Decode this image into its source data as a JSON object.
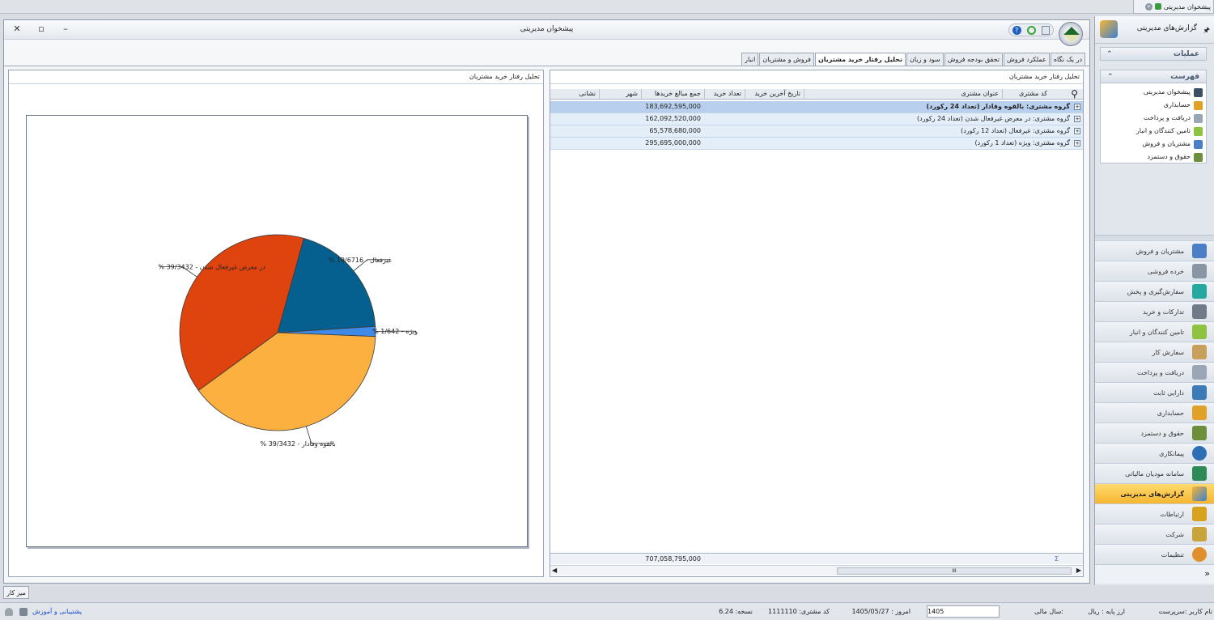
{
  "top_tab": {
    "label": "پیشخوان مدیریتی"
  },
  "window": {
    "title": "پیشخوان مدیریتی"
  },
  "tabs": [
    "در یک نگاه",
    "عملکرد فروش",
    "تحقق بودجه فروش",
    "سود و زیان",
    "تحلیل رفتار خرید مشتریان",
    "فروش و مشتریان",
    "انبار"
  ],
  "left_panel": {
    "title": "تحلیل رفتار خرید مشتریان"
  },
  "right_panel": {
    "title": "تحلیل رفتار خرید مشتریان"
  },
  "grid": {
    "headers": [
      "کد مشتری",
      "عنوان مشتری",
      "تاریخ آخرین خرید",
      "تعداد خرید",
      "جمع مبالغ خریدها",
      "شهر",
      "نشانی"
    ],
    "rows": [
      {
        "group": "گروه مشتری:  بالقوه وفادار (تعداد 24 رکورد)",
        "amount": "183,692,595,000"
      },
      {
        "group": "گروه مشتری:  در معرض غیرفعال شدن (تعداد 24 رکورد)",
        "amount": "162,092,520,000"
      },
      {
        "group": "گروه مشتری:  غیرفعال (تعداد 12 رکورد)",
        "amount": "65,578,680,000"
      },
      {
        "group": "گروه مشتری:  ویژه (تعداد 1 رکورد)",
        "amount": "295,695,000,000"
      }
    ],
    "total": "707,058,795,000",
    "sigma": "Σ",
    "scroll_glyph": "III"
  },
  "chart_data": {
    "type": "pie",
    "slices": [
      {
        "label": "غیرفعال - 19/6716 %",
        "value": 19.6716,
        "color": "#06608f"
      },
      {
        "label": "ویژه - 1/642 %",
        "value": 1.642,
        "color": "#3f8ae8"
      },
      {
        "label": "بالقوه وفادار - 39/3432 %",
        "value": 39.3432,
        "color": "#fbb040"
      },
      {
        "label": "در معرض غیرفعال شدن - 39/3432 %",
        "value": 39.3432,
        "color": "#e0440e"
      }
    ]
  },
  "sidebar": {
    "title": "گزارش‌های مدیریتی",
    "pin": "ꟷ",
    "operations": "عملیات",
    "list": "فهرست",
    "collapse": "«",
    "items": [
      "پیشخوان مدیریتی",
      "حسابداری",
      "دریافت و پرداخت",
      "تامین کنندگان و انبار",
      "مشتریان و فروش",
      "حقوق و دستمزد"
    ],
    "nav": [
      "مشتریان و فروش",
      "خرده فروشی",
      "سفارش‌گیری و پخش",
      "تدارکات و خرید",
      "تامین کنندگان و انبار",
      "سفارش کار",
      "دریافت و پرداخت",
      "دارایی ثابت",
      "حسابداری",
      "حقوق و دستمزد",
      "پیمانکاری",
      "سامانه مودیان مالیاتی",
      "گزارش‌های مدیریتی",
      "ارتباطات",
      "شرکت",
      "تنظیمات"
    ],
    "nav_active": "گزارش‌های مدیریتی",
    "expand": "»"
  },
  "desk_tab": "میز کار",
  "status": {
    "user": "نام کاربر :سرپرست",
    "currency": "ارز پایه :  ریال",
    "fiscal_label": "سال مالی:",
    "fiscal_value": "1405",
    "today": "امروز :  1405/05/27",
    "customer_code": "کد مشتری:  1111110",
    "version": "نسخه:  6.24",
    "support": "پشتیبانی و آموزش"
  },
  "colors": {
    "accent": "#f7b531",
    "selection": "#b8d0ee",
    "link": "#1a4bd1"
  }
}
